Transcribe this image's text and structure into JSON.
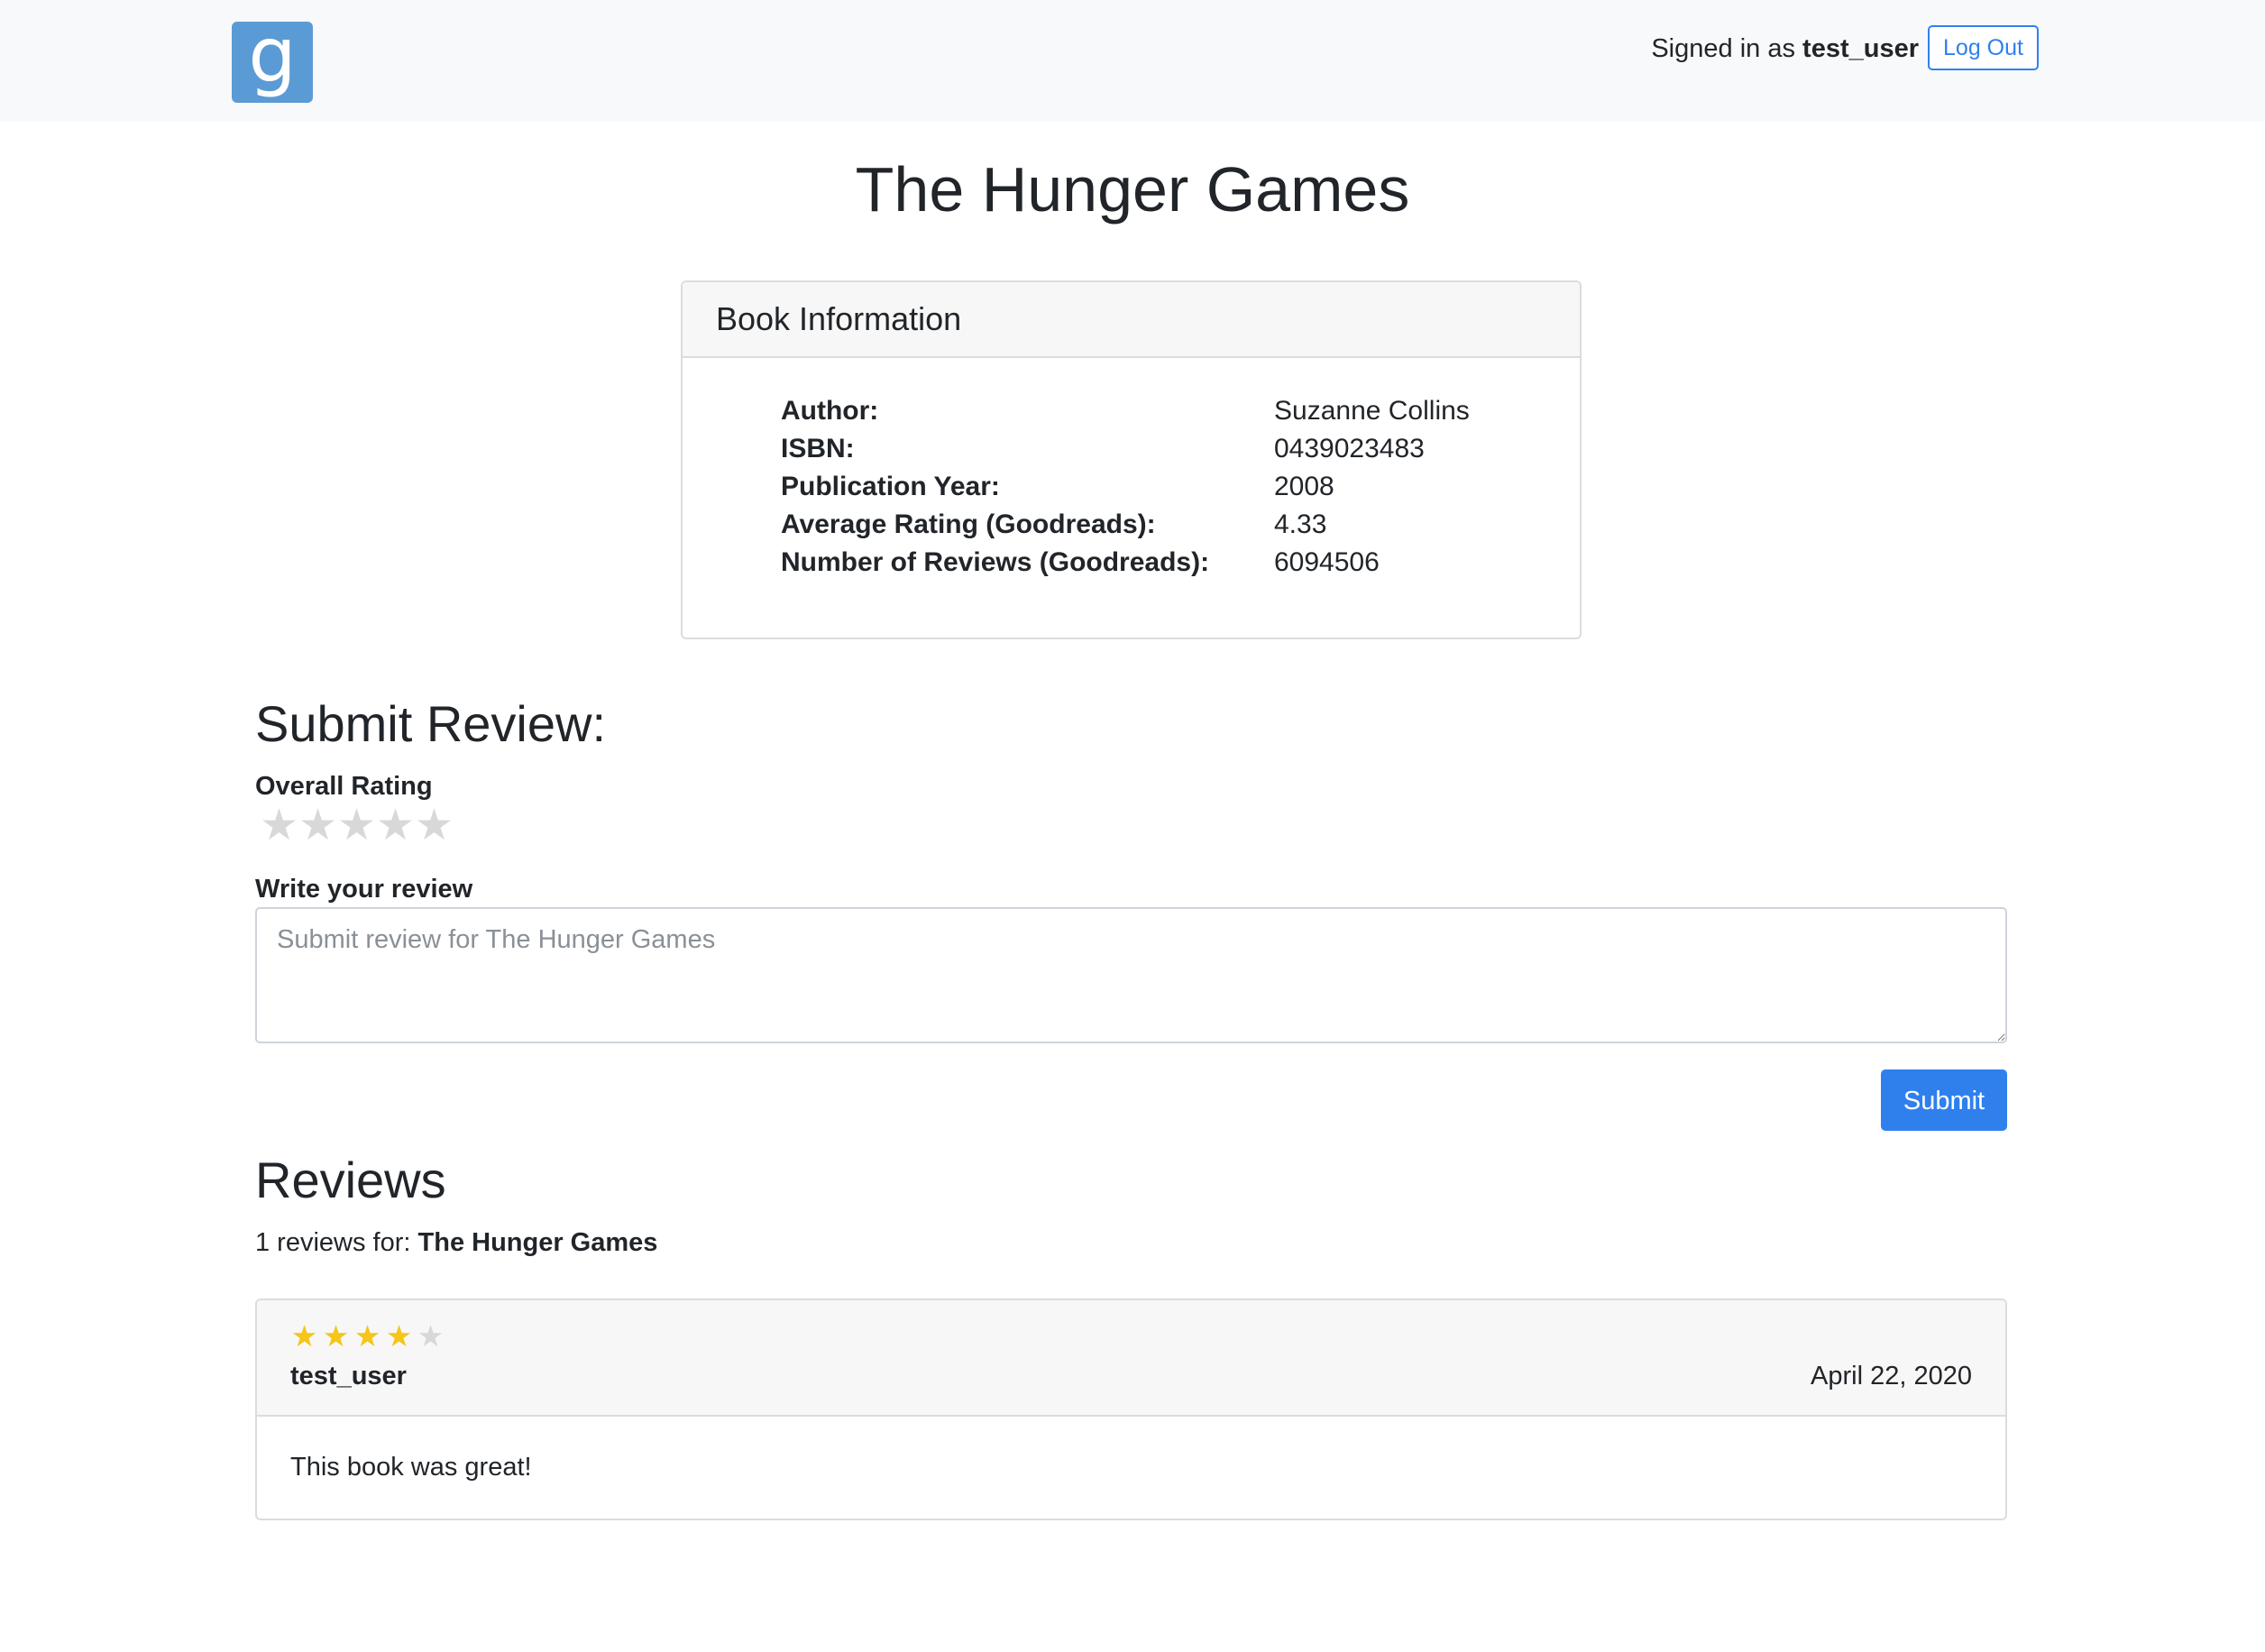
{
  "header": {
    "logo_letter": "g",
    "signed_in_prefix": "Signed in as",
    "username": "test_user",
    "logout_label": "Log Out"
  },
  "book": {
    "title": "The Hunger Games",
    "info_header": "Book Information",
    "fields": [
      {
        "label": "Author:",
        "value": "Suzanne Collins"
      },
      {
        "label": "ISBN:",
        "value": "0439023483"
      },
      {
        "label": "Publication Year:",
        "value": "2008"
      },
      {
        "label": "Average Rating (Goodreads):",
        "value": "4.33"
      },
      {
        "label": "Number of Reviews (Goodreads):",
        "value": "6094506"
      }
    ]
  },
  "submit_review": {
    "heading": "Submit Review:",
    "rating_label": "Overall Rating",
    "rating_max": 5,
    "rating_value": 0,
    "write_label": "Write your review",
    "placeholder": "Submit review for The Hunger Games",
    "submit_label": "Submit"
  },
  "reviews": {
    "heading": "Reviews",
    "count_text": "1 reviews for:",
    "book_title": "The Hunger Games",
    "items": [
      {
        "rating": 4,
        "rating_max": 5,
        "user": "test_user",
        "date": "April 22, 2020",
        "text": "This book was great!"
      }
    ]
  },
  "colors": {
    "accent": "#2f80ed",
    "logo_bg": "#5b9bd5",
    "star_on": "#f5c518",
    "star_off": "#d8d8d8",
    "navbar_bg": "#f8f9fa"
  },
  "icons": {
    "logo": "goodreads-g-logo",
    "star": "star-icon"
  }
}
